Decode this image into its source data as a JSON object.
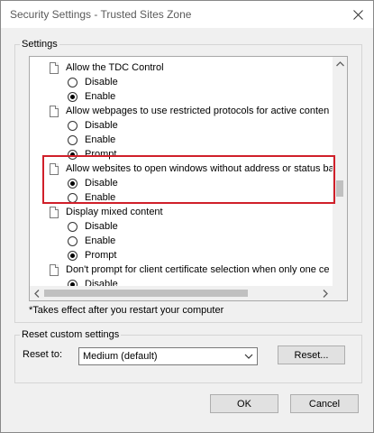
{
  "window": {
    "title": "Security Settings - Trusted Sites Zone",
    "close_icon": "close-icon"
  },
  "settings_group": {
    "label": "Settings",
    "items": [
      {
        "text": "Allow the TDC Control"
      },
      {
        "text": "Disable",
        "checked": false
      },
      {
        "text": "Enable",
        "checked": true
      },
      {
        "text": "Allow webpages to use restricted protocols for active conten"
      },
      {
        "text": "Disable",
        "checked": false
      },
      {
        "text": "Enable",
        "checked": false
      },
      {
        "text": "Prompt",
        "checked": true
      },
      {
        "text": "Allow websites to open windows without address or status ba"
      },
      {
        "text": "Disable",
        "checked": true
      },
      {
        "text": "Enable",
        "checked": false
      },
      {
        "text": "Display mixed content"
      },
      {
        "text": "Disable",
        "checked": false
      },
      {
        "text": "Enable",
        "checked": false
      },
      {
        "text": "Prompt",
        "checked": true
      },
      {
        "text": "Don't prompt for client certificate selection when only one ce"
      },
      {
        "text": "Disable",
        "checked": true
      }
    ],
    "highlight_color": "#d0202a"
  },
  "note": "*Takes effect after you restart your computer",
  "reset_group": {
    "label": "Reset custom settings",
    "reset_to_label": "Reset to:",
    "selected_value": "Medium (default)",
    "reset_button": "Reset..."
  },
  "buttons": {
    "ok": "OK",
    "cancel": "Cancel"
  }
}
